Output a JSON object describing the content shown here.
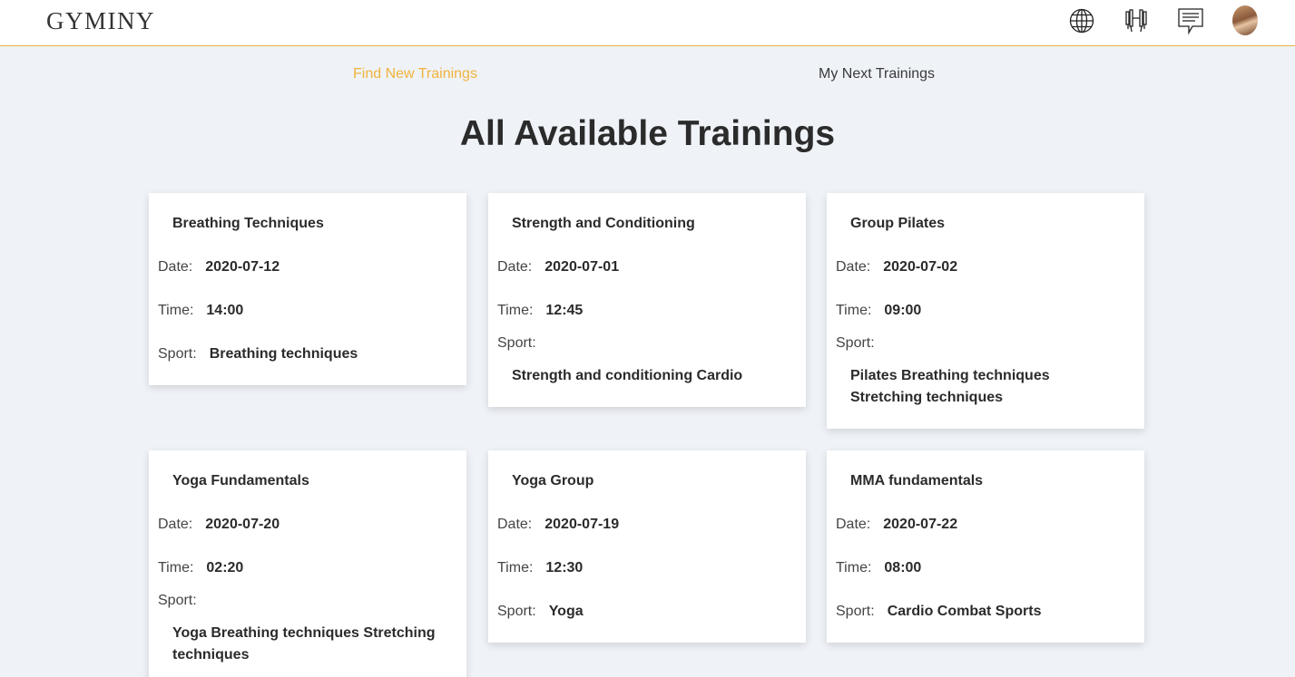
{
  "app": {
    "logo": "GYMINY"
  },
  "header_icons": [
    "globe-icon",
    "dumbbell-icon",
    "chat-icon",
    "avatar"
  ],
  "tabs": [
    {
      "label": "Find New Trainings",
      "active": true
    },
    {
      "label": "My Next Trainings",
      "active": false
    }
  ],
  "page_title": "All Available Trainings",
  "labels": {
    "date": "Date:",
    "time": "Time:",
    "sport": "Sport:"
  },
  "trainings": [
    {
      "title": "Breathing Techniques",
      "date": "2020-07-12",
      "time": "14:00",
      "sport": "Breathing techniques"
    },
    {
      "title": "Strength and Conditioning",
      "date": "2020-07-01",
      "time": "12:45",
      "sport": "Strength and conditioning Cardio"
    },
    {
      "title": "Group Pilates",
      "date": "2020-07-02",
      "time": "09:00",
      "sport": "Pilates Breathing techniques Stretching techniques"
    },
    {
      "title": "Yoga Fundamentals",
      "date": "2020-07-20",
      "time": "02:20",
      "sport": "Yoga Breathing techniques Stretching techniques"
    },
    {
      "title": "Yoga Group",
      "date": "2020-07-19",
      "time": "12:30",
      "sport": "Yoga"
    },
    {
      "title": "MMA fundamentals",
      "date": "2020-07-22",
      "time": "08:00",
      "sport": "Cardio Combat Sports"
    }
  ],
  "colors": {
    "accent": "#f0b43c",
    "background": "#eff2f7",
    "card": "#ffffff"
  }
}
